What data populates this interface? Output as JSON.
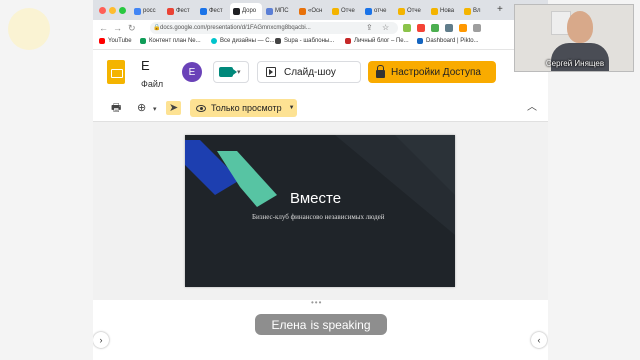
{
  "browser": {
    "tabs": [
      {
        "label": "росс",
        "color": "#4285f4"
      },
      {
        "label": "Фест",
        "color": "#ea4335"
      },
      {
        "label": "Фест",
        "color": "#1a73e8"
      },
      {
        "label": "Доро",
        "color": "#202124"
      },
      {
        "label": "МПС",
        "color": "#5b7fd6"
      },
      {
        "label": "«Осн",
        "color": "#e8710a"
      },
      {
        "label": "Отче",
        "color": "#f4b400"
      },
      {
        "label": "отче",
        "color": "#1a73e8"
      },
      {
        "label": "Отче",
        "color": "#f4b400"
      },
      {
        "label": "Нова",
        "color": "#f4b400"
      },
      {
        "label": "Вл",
        "color": "#f4b400"
      }
    ],
    "new_tab": "+",
    "url": "docs.google.com/presentation/d/1FAGmnxcmg8bqacbi...",
    "bookmarks": [
      {
        "label": "YouTube",
        "color": "#ff0000"
      },
      {
        "label": "Контент план Ne...",
        "color": "#0f9d58"
      },
      {
        "label": "Все дизайны — С...",
        "color": "#00c4cc"
      },
      {
        "label": "Supa - шаблоны...",
        "color": "#444444"
      },
      {
        "label": "Личный блог – Пе...",
        "color": "#c62828"
      },
      {
        "label": "Dashboard | Pikto...",
        "color": "#1565c0"
      }
    ]
  },
  "slides_app": {
    "doc_title": "E",
    "file_menu": "Файл",
    "avatar_initial": "E",
    "slideshow_label": "Слайд-шоу",
    "share_label": "Настройки Доступа"
  },
  "toolbar": {
    "view_only_label": "Только просмотр"
  },
  "slide": {
    "title": "Вместе",
    "subtitle": "Бизнес-клуб финансово независимых людей"
  },
  "meeting": {
    "speaker_name": "Елена",
    "speaking_suffix": "is speaking",
    "webcam_name": "Сергей Инящев"
  },
  "colors": {
    "share_button": "#f9ab00",
    "view_only_badge": "#fde293",
    "slide_background": "#1f2429",
    "slide_accent_blue": "#1d3fb0",
    "slide_accent_green": "#57c4a3"
  }
}
